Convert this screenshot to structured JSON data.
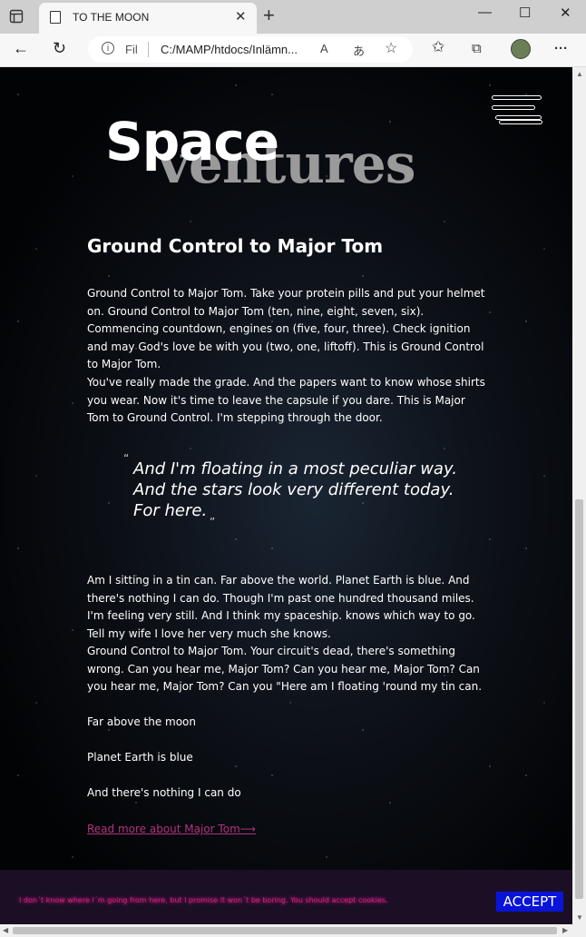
{
  "browser": {
    "tab_title": "TO THE MOON",
    "tab_close": "✕",
    "new_tab": "+",
    "window": {
      "minimize": "—",
      "maximize": "☐",
      "close": "✕"
    },
    "address": {
      "scheme_label": "Fil",
      "url": "C:/MAMP/htdocs/Inlämn..."
    },
    "icons": {
      "back": "←",
      "reload": "↻",
      "read_aloud": "A",
      "translate": "あ",
      "add_favorite": "☆",
      "favorites": "✩",
      "collections": "⧉",
      "menu": "···"
    }
  },
  "page": {
    "logo": {
      "line1": "Space",
      "line2": "ventures"
    },
    "heading": "Ground Control to Major Tom",
    "paragraph1": "Ground Control to Major Tom. Take your protein pills and put your helmet on. Ground Control to Major Tom (ten, nine, eight, seven, six). Commencing countdown, engines on (five, four, three). Check ignition and may God's love be with you (two, one, liftoff). This is Ground Control to Major Tom.",
    "paragraph2": "You've really made the grade. And the papers want to know whose shirts you wear. Now it's time to leave the capsule if you dare. This is Major Tom to Ground Control. I'm stepping through the door.",
    "quote": {
      "lines": [
        "And I'm floating in a most peculiar way.",
        "And the stars look very different today.",
        "For here."
      ],
      "open_mark": "“",
      "close_mark": "”"
    },
    "paragraph3": "Am I sitting in a tin can. Far above the world. Planet Earth is blue. And there's nothing I can do. Though I'm past one hundred thousand miles. I'm feeling very still. And I think my spaceship. knows which way to go. Tell my wife I love her very much she knows.",
    "paragraph4": "Ground Control to Major Tom. Your circuit's dead, there's something wrong. Can you hear me, Major Tom? Can you hear me, Major Tom? Can you hear me, Major Tom? Can you \"Here am I floating 'round my tin can.",
    "lines": [
      "Far above the moon",
      "Planet Earth is blue",
      "And there's nothing I can do"
    ],
    "read_more": "Read more about Major Tom⟶"
  },
  "cookie": {
    "text": "I don´t know where I´m going from here, but I promise it won´t be boring. You should accept cookies.",
    "accept": "ACCEPT"
  },
  "colors": {
    "link": "#b2327f",
    "cookie_text": "#d81b7f",
    "accept_button": "#0a14d9"
  }
}
